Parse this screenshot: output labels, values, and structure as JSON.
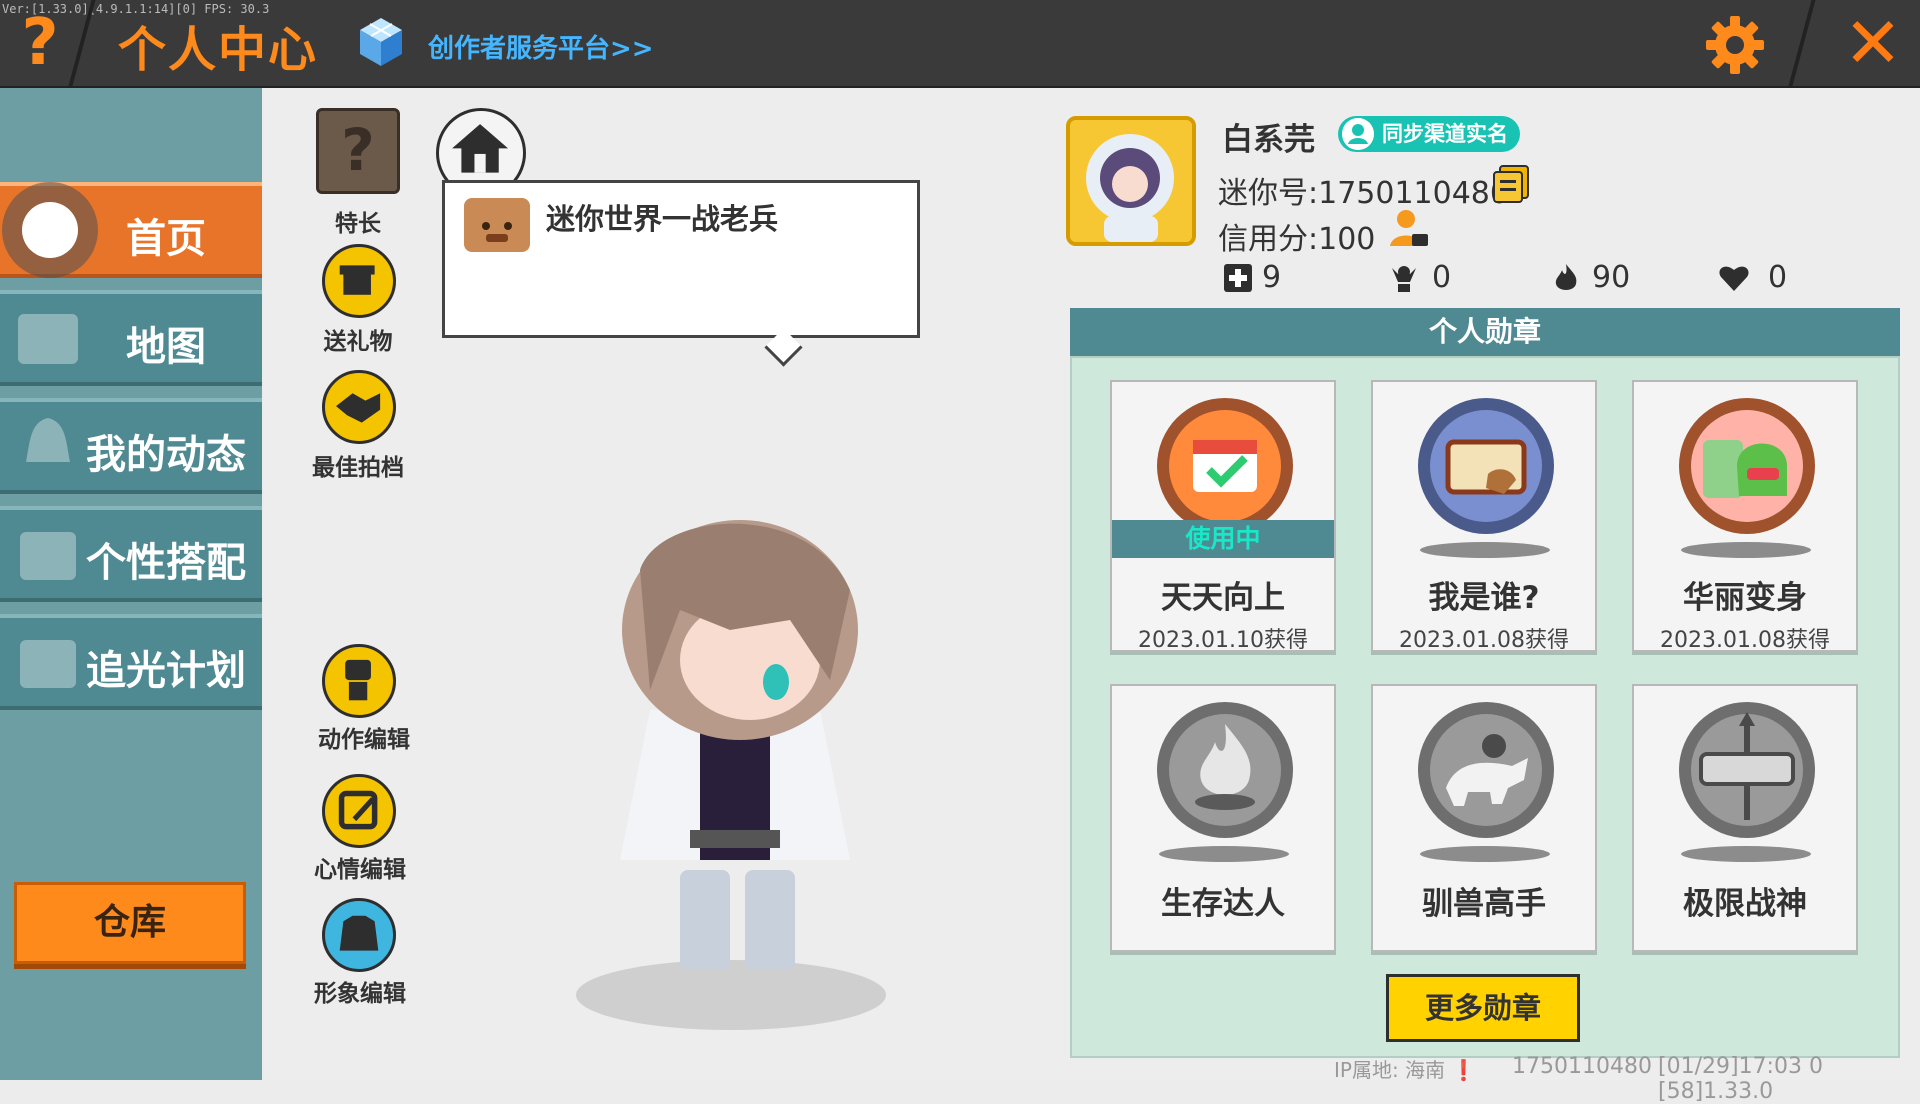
{
  "debug": {
    "version_text": "Ver:[1.33.0][4.9.1.1:14][0] FPS: 30.3"
  },
  "header": {
    "help_glyph": "?",
    "title": "个人中心",
    "creator_link": "创作者服务平台>>",
    "close_glyph": "✕",
    "accent_color": "#ff8a1c"
  },
  "sidebar": {
    "items": [
      {
        "label": "首页",
        "icon": "home-icon",
        "active": true
      },
      {
        "label": "地图",
        "icon": "map-icon",
        "active": false
      },
      {
        "label": "我的动态",
        "icon": "bell-icon",
        "active": false
      },
      {
        "label": "个性搭配",
        "icon": "outfit-icon",
        "active": false
      },
      {
        "label": "追光计划",
        "icon": "light-plan-icon",
        "active": false
      }
    ],
    "warehouse_label": "仓库"
  },
  "actions": {
    "talent": {
      "label": "特长",
      "glyph": "?"
    },
    "gift": {
      "label": "送礼物"
    },
    "partner": {
      "label": "最佳拍档"
    },
    "action_edit": {
      "label": "动作编辑"
    },
    "mood_edit": {
      "label": "心情编辑"
    },
    "look_edit": {
      "label": "形象编辑"
    }
  },
  "bubble": {
    "text": "迷你世界一战老兵"
  },
  "profile": {
    "nickname": "白系芫",
    "verify_label": "同步渠道实名",
    "mini_id": "迷你号:1750110480",
    "credit": "信用分:100",
    "stats": [
      {
        "icon": "plus-book-icon",
        "value": "9"
      },
      {
        "icon": "fan-icon",
        "value": "0"
      },
      {
        "icon": "fire-icon",
        "value": "90"
      },
      {
        "icon": "heart-icon",
        "value": "0"
      }
    ]
  },
  "medals": {
    "header": "个人勋章",
    "items": [
      {
        "name": "天天向上",
        "date": "2023.01.10获得",
        "in_use": "使用中",
        "icon": "calendar-medal-icon"
      },
      {
        "name": "我是谁?",
        "date": "2023.01.08获得",
        "in_use": "",
        "icon": "id-card-medal-icon"
      },
      {
        "name": "华丽变身",
        "date": "2023.01.08获得",
        "in_use": "",
        "icon": "transform-medal-icon"
      },
      {
        "name": "生存达人",
        "date": "",
        "in_use": "",
        "icon": "campfire-medal-icon"
      },
      {
        "name": "驯兽高手",
        "date": "",
        "in_use": "",
        "icon": "tamer-medal-icon"
      },
      {
        "name": "极限战神",
        "date": "",
        "in_use": "",
        "icon": "boss-medal-icon"
      }
    ],
    "more_label": "更多勋章"
  },
  "footer": {
    "ip": "IP属地: 海南 ❗",
    "uid": "1750110480",
    "time": "[01/29]17:03 0 [58]1.33.0"
  }
}
